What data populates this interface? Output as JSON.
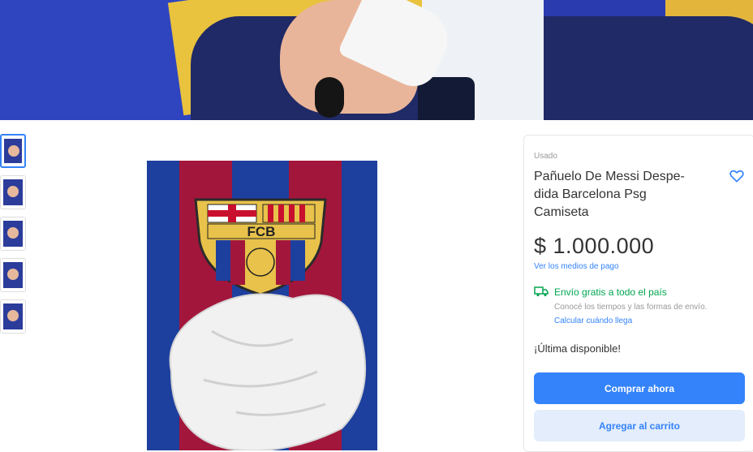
{
  "product": {
    "condition": "Usado",
    "title": "Pañuelo De Messi Despe- dida Barcelona Psg Camiseta",
    "price": "$ 1.000.000",
    "payments_link": "Ver los medios de pago",
    "shipping": {
      "title": "Envío gratis a todo el país",
      "subtitle": "Conocé los tiempos y las formas de envío.",
      "link": "Calcular cuándo llega"
    },
    "stock": "¡Última disponible!",
    "buy_label": "Comprar ahora",
    "cart_label": "Agregar al carrito",
    "favorite_icon": "heart-icon"
  },
  "gallery": {
    "thumbnail_count": 5,
    "selected_thumbnail": 1,
    "main_image": "Barcelona scarf with FCB crest and crumpled tissue",
    "crest_text": "FCB"
  },
  "colors": {
    "accent": "#3483fa",
    "shipping_green": "#00a650",
    "barca_blue": "#1d3f9e",
    "barca_red": "#a3163b"
  }
}
